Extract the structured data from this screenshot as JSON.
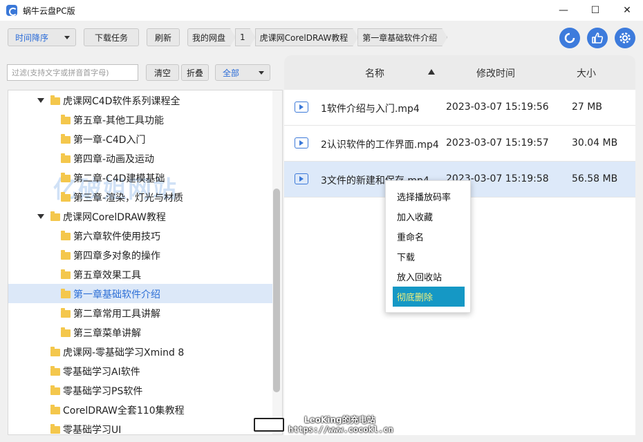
{
  "window": {
    "title": "蜗牛云盘PC版",
    "minimize": "—",
    "maximize": "☐",
    "close": "✕"
  },
  "toolbar": {
    "sort_dropdown": "时间降序",
    "download_tasks": "下载任务",
    "refresh": "刷新",
    "breadcrumb": [
      "我的网盘",
      "1",
      "虎课网CorelDRAW教程",
      "第一章基础软件介绍"
    ],
    "icons": [
      "sync-icon",
      "thumbs-up-icon",
      "gear-icon"
    ]
  },
  "filter": {
    "placeholder": "过滤(支持文字或拼音首字母)",
    "clear": "清空",
    "collapse": "折叠",
    "scope": "全部"
  },
  "watermark": "亿破姐网站",
  "tree": [
    {
      "label": "虎课网C4D软件系列课程全",
      "level": 1,
      "expanded": true
    },
    {
      "label": "第五章-其他工具功能",
      "level": 2
    },
    {
      "label": "第一章-C4D入门",
      "level": 2
    },
    {
      "label": "第四章-动画及运动",
      "level": 2
    },
    {
      "label": "第二章-C4D建模基础",
      "level": 2
    },
    {
      "label": "第三章-渲染，灯光与材质",
      "level": 2
    },
    {
      "label": "虎课网CorelDRAW教程",
      "level": 1,
      "expanded": true
    },
    {
      "label": "第六章软件使用技巧",
      "level": 2
    },
    {
      "label": "第四章多对象的操作",
      "level": 2
    },
    {
      "label": "第五章效果工具",
      "level": 2
    },
    {
      "label": "第一章基础软件介绍",
      "level": 2,
      "selected": true
    },
    {
      "label": "第二章常用工具讲解",
      "level": 2
    },
    {
      "label": "第三章菜单讲解",
      "level": 2
    },
    {
      "label": "虎课网-零基础学习Xmind 8",
      "level": 1
    },
    {
      "label": "零基础学习AI软件",
      "level": 1
    },
    {
      "label": "零基础学习PS软件",
      "level": 1
    },
    {
      "label": "CorelDRAW全套110集教程",
      "level": 1
    },
    {
      "label": "零基础学习UI",
      "level": 1
    }
  ],
  "table": {
    "headers": {
      "name": "名称",
      "modified": "修改时间",
      "size": "大小"
    },
    "rows": [
      {
        "name": "1软件介绍与入门.mp4",
        "modified": "2023-03-07 15:19:56",
        "size": "27 MB"
      },
      {
        "name": "2认识软件的工作界面.mp4",
        "modified": "2023-03-07 15:19:57",
        "size": "30.04 MB"
      },
      {
        "name": "3文件的新建和保存.mp4",
        "modified": "2023-03-07 15:19:58",
        "size": "56.58 MB",
        "selected": true
      }
    ]
  },
  "context_menu": [
    {
      "label": "选择播放码率"
    },
    {
      "label": "加入收藏"
    },
    {
      "label": "重命名"
    },
    {
      "label": "下载"
    },
    {
      "label": "放入回收站"
    },
    {
      "label": "彻底删除",
      "active": true
    }
  ],
  "footer_watermark": {
    "line1": "LeoKing的充电站",
    "line2": "https://www.cocokl.cn"
  }
}
